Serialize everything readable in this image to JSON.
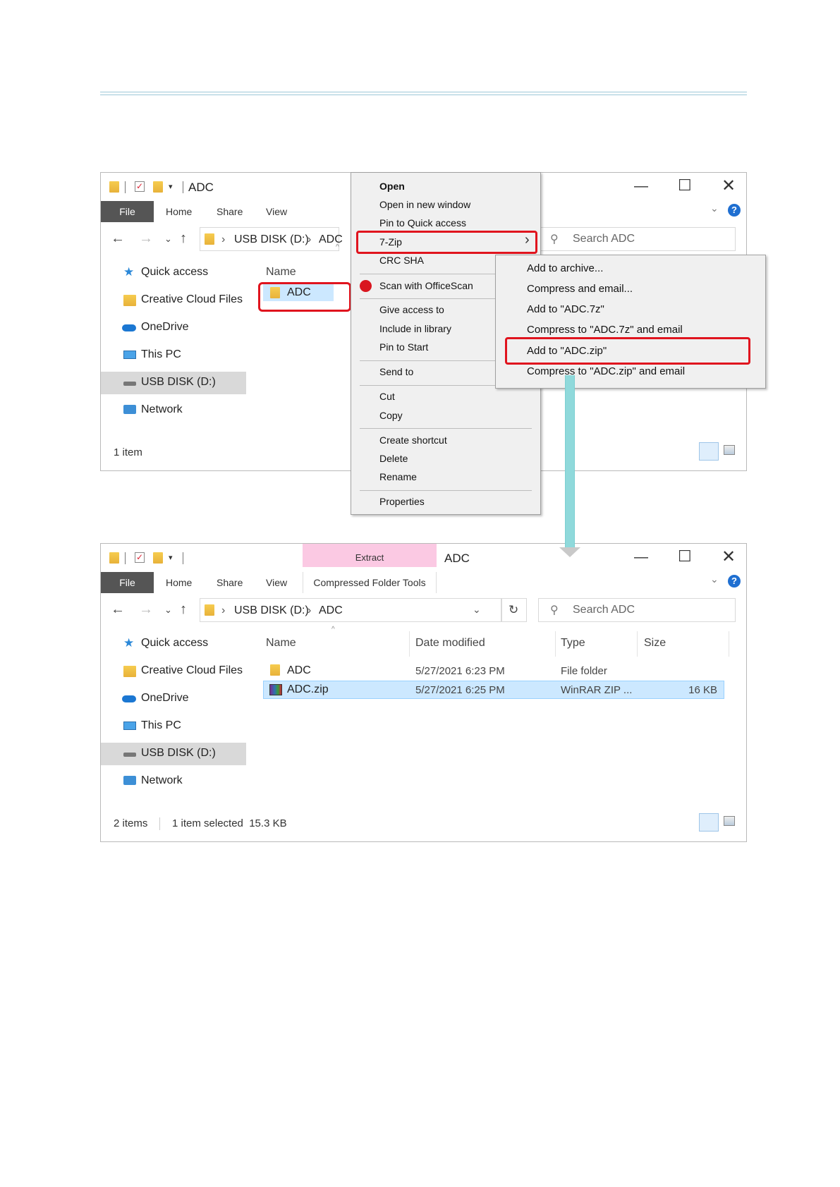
{
  "window1": {
    "title": "ADC",
    "ribbon_tabs": [
      "File",
      "Home",
      "Share",
      "View"
    ],
    "address": {
      "drive": "USB DISK (D:)",
      "folder": "ADC"
    },
    "search_placeholder": "Search ADC",
    "sidebar": [
      "Quick access",
      "Creative Cloud Files",
      "OneDrive",
      "This PC",
      "USB DISK (D:)",
      "Network"
    ],
    "column_name": "Name",
    "file_item": "ADC",
    "status": "1 item"
  },
  "context_menu": {
    "items": [
      "Open",
      "Open in new window",
      "Pin to Quick access",
      "7-Zip",
      "CRC SHA",
      "Scan with OfficeScan",
      "Give access to",
      "Include in library",
      "Pin to Start",
      "Send to",
      "Cut",
      "Copy",
      "Create shortcut",
      "Delete",
      "Rename",
      "Properties"
    ]
  },
  "submenu": {
    "items": [
      "Add to archive...",
      "Compress and email...",
      "Add to \"ADC.7z\"",
      "Compress to \"ADC.7z\" and email",
      "Add to \"ADC.zip\"",
      "Compress to \"ADC.zip\" and email"
    ]
  },
  "window2": {
    "context_tab": "Extract",
    "context_group": "Compressed Folder Tools",
    "title": "ADC",
    "ribbon_tabs": [
      "File",
      "Home",
      "Share",
      "View"
    ],
    "address": {
      "drive": "USB DISK (D:)",
      "folder": "ADC"
    },
    "search_placeholder": "Search ADC",
    "sidebar": [
      "Quick access",
      "Creative Cloud Files",
      "OneDrive",
      "This PC",
      "USB DISK (D:)",
      "Network"
    ],
    "columns": [
      "Name",
      "Date modified",
      "Type",
      "Size"
    ],
    "rows": [
      {
        "name": "ADC",
        "date": "5/27/2021 6:23 PM",
        "type": "File folder",
        "size": ""
      },
      {
        "name": "ADC.zip",
        "date": "5/27/2021 6:25 PM",
        "type": "WinRAR ZIP ...",
        "size": "16 KB"
      }
    ],
    "status_count": "2 items",
    "status_selected": "1 item selected  15.3 KB"
  },
  "colors": {
    "highlight": "#e0141e",
    "arrow": "#8fd9db",
    "selection": "#cce8ff",
    "context_tab": "#fbc9e3"
  }
}
